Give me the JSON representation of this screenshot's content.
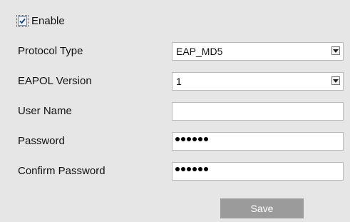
{
  "enable": {
    "label": "Enable",
    "checked": true
  },
  "fields": {
    "protocol_type": {
      "label": "Protocol Type",
      "value": "EAP_MD5"
    },
    "eapol_version": {
      "label": "EAPOL Version",
      "value": "1"
    },
    "user_name": {
      "label": "User Name",
      "value": ""
    },
    "password": {
      "label": "Password",
      "masked_length": 6
    },
    "confirm_password": {
      "label": "Confirm Password",
      "masked_length": 6
    }
  },
  "actions": {
    "save_label": "Save"
  },
  "colors": {
    "panel_bg": "#e6e6e6",
    "button_bg": "#9b9b9b",
    "input_border": "#b9b9b9"
  },
  "icons": {
    "dropdown": "chevron-down-icon",
    "checkbox": "check-icon"
  }
}
